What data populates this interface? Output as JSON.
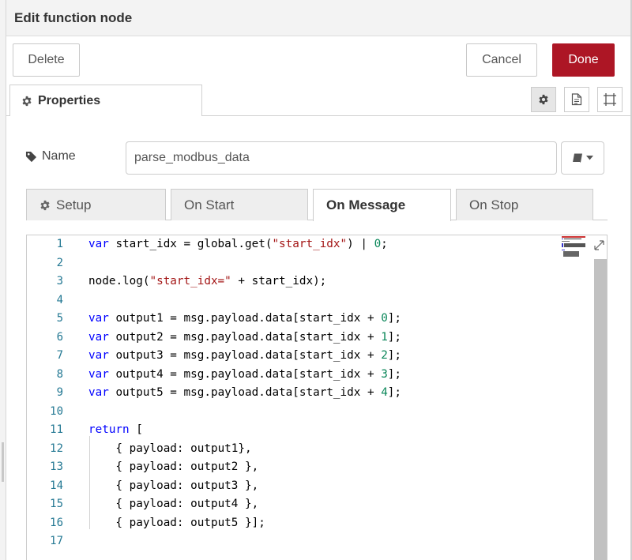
{
  "tray": {
    "title": "Edit function node"
  },
  "buttons": {
    "delete": "Delete",
    "cancel": "Cancel",
    "done": "Done"
  },
  "tabs": {
    "properties": "Properties"
  },
  "name": {
    "label": "Name",
    "value": "parse_modbus_data"
  },
  "subtabs": [
    {
      "label": "Setup",
      "active": false
    },
    {
      "label": "On Start",
      "active": false
    },
    {
      "label": "On Message",
      "active": true
    },
    {
      "label": "On Stop",
      "active": false
    }
  ],
  "editor": {
    "line_numbers": [
      "1",
      "2",
      "3",
      "4",
      "5",
      "6",
      "7",
      "8",
      "9",
      "10",
      "11",
      "12",
      "13",
      "14",
      "15",
      "16",
      "17"
    ],
    "lines": [
      "var start_idx = global.get(\"start_idx\") | 0;",
      "",
      "node.log(\"start_idx=\" + start_idx);",
      "",
      "var output1 = msg.payload.data[start_idx + 0];",
      "var output2 = msg.payload.data[start_idx + 1];",
      "var output3 = msg.payload.data[start_idx + 2];",
      "var output4 = msg.payload.data[start_idx + 3];",
      "var output5 = msg.payload.data[start_idx + 4];",
      "",
      "return [",
      "    { payload: output1},",
      "    { payload: output2 },",
      "    { payload: output3 },",
      "    { payload: output4 },",
      "    { payload: output5 }];",
      ""
    ]
  },
  "icons": {
    "properties": "gear-icon",
    "settings": "gear-icon",
    "description": "document-icon",
    "appearance": "frame-icon",
    "name": "tag-icon",
    "library": "book-icon",
    "expand": "expand-icon"
  },
  "colors": {
    "done": "#ad1625",
    "keyword": "#0000ff",
    "string": "#a31515",
    "number": "#098658",
    "line_number": "#237893"
  }
}
